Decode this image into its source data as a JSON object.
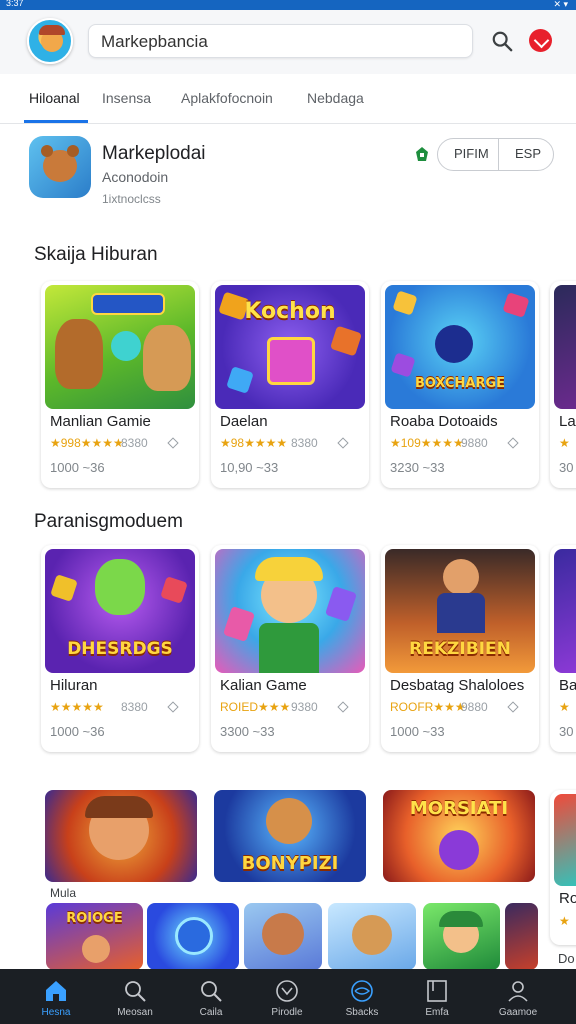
{
  "status_bar": {
    "left": "3:37",
    "right": "✕ ▾"
  },
  "header": {
    "search_value": "Markepbancia"
  },
  "tabs": [
    {
      "label": "Hiloanal",
      "active": true
    },
    {
      "label": "Insensa",
      "active": false
    },
    {
      "label": "Aplakfofocnoin",
      "active": false
    },
    {
      "label": "Nebdaga",
      "active": false
    }
  ],
  "featured": {
    "title": "Markeplodai",
    "developer": "Aconodoin",
    "subtitle": "1ixtnoclcss",
    "buttons": [
      "PIFIM",
      "ESP"
    ]
  },
  "sections": [
    {
      "title": "Skaija Hiburan",
      "cards": [
        {
          "name": "Manlian Gamie",
          "rating": "★998★★★★",
          "size": "8380",
          "downloads": "1000 ~36",
          "thumb_text": "WAGALIA"
        },
        {
          "name": "Daelan",
          "rating": "★98★★★★",
          "size": "8380",
          "downloads": "10,90 ~33",
          "thumb_text": "Kochon"
        },
        {
          "name": "Roaba Dotoaids",
          "rating": "★109★★★★",
          "size": "9880",
          "downloads": "3230 ~33",
          "thumb_text": "BOXCHARGE"
        },
        {
          "name": "La",
          "rating": "★",
          "size": "",
          "downloads": "30",
          "thumb_text": ""
        }
      ]
    },
    {
      "title": "Paranisgmoduem",
      "cards": [
        {
          "name": "Hiluran",
          "rating": "★★★★★",
          "size": "8380",
          "downloads": "1000 ~36",
          "thumb_text": "DHESRDGS"
        },
        {
          "name": "Kalian Game",
          "rating": "ROIED★★★",
          "size": "9380",
          "downloads": "3300 ~33",
          "thumb_text": ""
        },
        {
          "name": "Desbatag Shaloloes",
          "rating": "ROOFR★★★",
          "size": "9880",
          "downloads": "1000 ~33",
          "thumb_text": "REKZIBIEN"
        },
        {
          "name": "Ba",
          "rating": "★",
          "size": "",
          "downloads": "30",
          "thumb_text": ""
        }
      ]
    }
  ],
  "row3": {
    "tiles": [
      {
        "thumb_text": ""
      },
      {
        "thumb_text": "BONYPIZI"
      },
      {
        "thumb_text": "MORSIATI"
      },
      {
        "thumb_text": ""
      }
    ],
    "label": "Mula",
    "side_name": "Ro",
    "side_rating": "★",
    "side_dl": "Do"
  },
  "row4": {
    "tiles": [
      {
        "thumb_text": "ROIOGE"
      },
      {
        "thumb_text": ""
      },
      {
        "thumb_text": ""
      },
      {
        "thumb_text": ""
      },
      {
        "thumb_text": ""
      },
      {
        "thumb_text": ""
      }
    ]
  },
  "bottom_nav": [
    {
      "label": "Hesna",
      "icon": "home-icon",
      "active": true
    },
    {
      "label": "Meosan",
      "icon": "search-icon",
      "active": false
    },
    {
      "label": "Caila",
      "icon": "search-icon",
      "active": false
    },
    {
      "label": "Pirodle",
      "icon": "shield-icon",
      "active": false
    },
    {
      "label": "Sbacks",
      "icon": "globe-icon",
      "active": false
    },
    {
      "label": "Emfa",
      "icon": "book-icon",
      "active": false
    },
    {
      "label": "Gaamoe",
      "icon": "user-icon",
      "active": false
    }
  ],
  "colors": {
    "status_bar": "#1565c0",
    "accent": "#1a73e8",
    "star": "#e8a311",
    "bottom_nav_bg": "#1b1f24",
    "record_button": "#e8202c"
  }
}
